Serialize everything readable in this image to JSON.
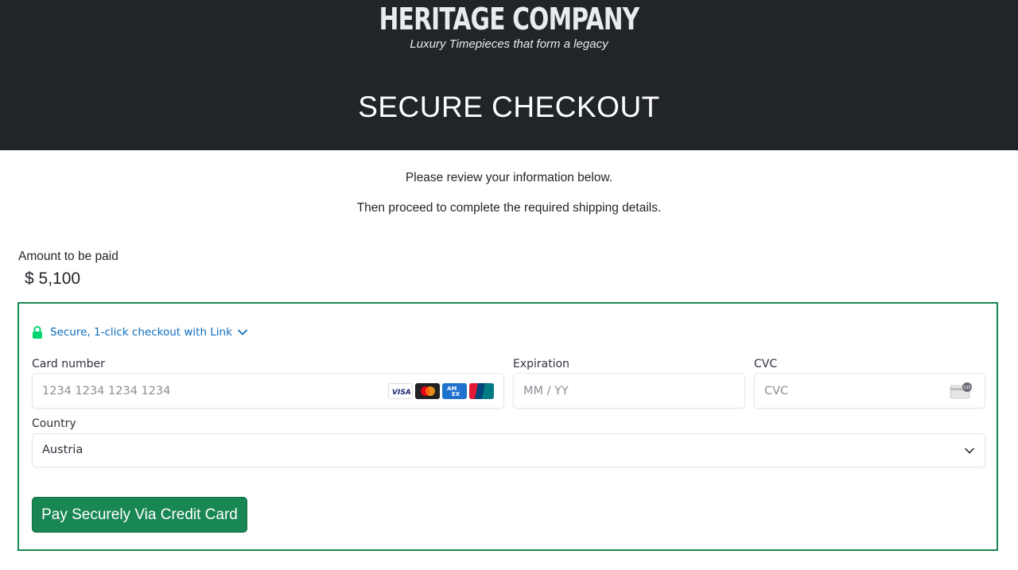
{
  "header": {
    "brand": "HERITAGE COMPANY",
    "tagline": "Luxury Timepieces that form a legacy",
    "title": "SECURE CHECKOUT"
  },
  "intro": {
    "line1": "Please review your information below.",
    "line2": "Then proceed to complete the required shipping details."
  },
  "amount": {
    "label": "Amount to be paid",
    "value": "$ 5,100"
  },
  "payment": {
    "link_text": "Secure, 1-click checkout with Link",
    "card_number_label": "Card number",
    "card_number_placeholder": "1234 1234 1234 1234",
    "expiration_label": "Expiration",
    "expiration_placeholder": "MM / YY",
    "cvc_label": "CVC",
    "cvc_placeholder": "CVC",
    "country_label": "Country",
    "country_value": "Austria",
    "card_brands": [
      "visa-logo",
      "mastercard-logo",
      "amex-logo",
      "unionpay-logo"
    ],
    "pay_button": "Pay Securely Via Credit Card"
  },
  "colors": {
    "header_bg": "#212529",
    "accent": "#198754",
    "link": "#0d6ebf",
    "lock": "#00d66f"
  }
}
